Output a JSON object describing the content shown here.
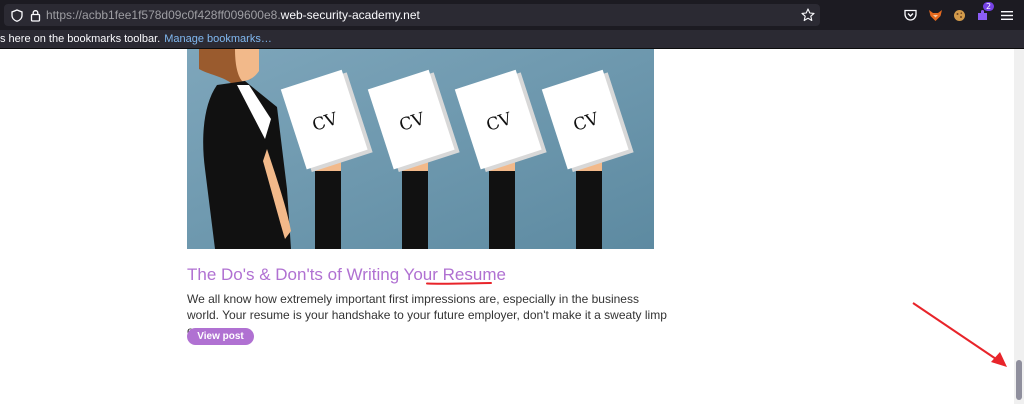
{
  "browser": {
    "url_prefix": "https://acbb1fee1f578d09c0f428ff009600e8.",
    "url_domain": "web-security-academy.net",
    "toolbar_icons": [
      "pocket-icon",
      "fox-extension-icon",
      "cookie-extension-icon",
      "extensions-icon",
      "menu-icon"
    ],
    "extensions_badge": "2"
  },
  "bookmarks_bar": {
    "text": "s here on the bookmarks toolbar.",
    "manage_link": "Manage bookmarks…"
  },
  "post": {
    "image_labels": [
      "CV",
      "CV",
      "CV",
      "CV"
    ],
    "title": "The Do's & Don'ts of Writing Your ",
    "title_emphasis": "Resume",
    "description": "We all know how extremely important first impressions are, especially in the business world. Your resume is your handshake to your future employer, don't make it a sweaty limp one.",
    "view_button": "View post"
  },
  "colors": {
    "accent": "#b071d2",
    "annotation": "#e8242a",
    "toolbar_bg": "#1c1b22"
  }
}
